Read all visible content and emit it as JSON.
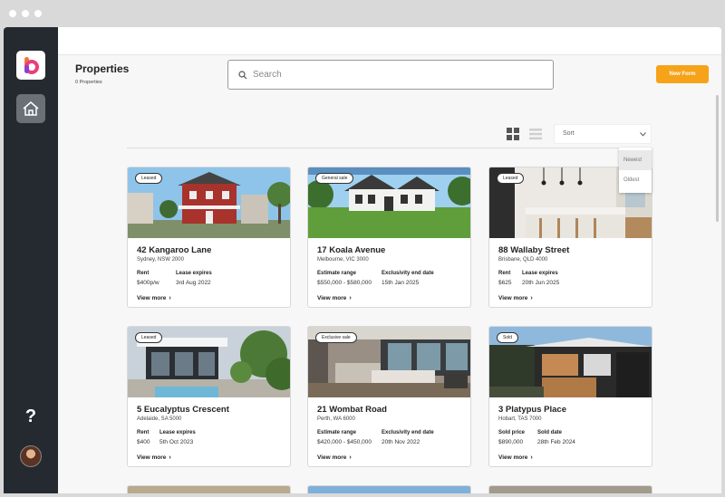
{
  "header": {
    "title": "Properties",
    "count": "0 Properties",
    "search_placeholder": "Search",
    "new_form_label": "New Form"
  },
  "toolbar": {
    "sort_label": "Sort",
    "sort_options": [
      "Newest",
      "Oldest"
    ]
  },
  "colors": {
    "accent": "#f6a31a",
    "sidebar": "#252a30"
  },
  "properties": [
    {
      "badge": "Leased",
      "title": "42 Kangaroo Lane",
      "location": "Sydney, NSW 2000",
      "field1_label": "Rent",
      "field1_value": "$400p/w",
      "field2_label": "Lease expires",
      "field2_value": "3rd Aug 2022",
      "view_more": "View more"
    },
    {
      "badge": "General sale",
      "title": "17 Koala Avenue",
      "location": "Melbourne, VIC 3000",
      "field1_label": "Estimate range",
      "field1_value": "$550,000 - $580,000",
      "field2_label": "Exclusivity end date",
      "field2_value": "15th Jan 2025",
      "view_more": "View more"
    },
    {
      "badge": "Leased",
      "title": "88 Wallaby Street",
      "location": "Brisbane, QLD 4000",
      "field1_label": "Rent",
      "field1_value": "$625",
      "field2_label": "Lease expires",
      "field2_value": "20th Jun 2025",
      "view_more": "View more"
    },
    {
      "badge": "Leased",
      "title": "5 Eucalyptus Crescent",
      "location": "Adelaide, SA 5000",
      "field1_label": "Rent",
      "field1_value": "$400",
      "field2_label": "Lease expires",
      "field2_value": "5th Oct 2023",
      "view_more": "View more"
    },
    {
      "badge": "Exclusive sale",
      "title": "21 Wombat Road",
      "location": "Perth, WA 6000",
      "field1_label": "Estimate range",
      "field1_value": "$420,000 - $450,000",
      "field2_label": "Exclusivity end date",
      "field2_value": "20th Nov 2022",
      "view_more": "View more"
    },
    {
      "badge": "Sold",
      "title": "3 Platypus Place",
      "location": "Hobart, TAS 7000",
      "field1_label": "Sold price",
      "field1_value": "$890,000",
      "field2_label": "Sold date",
      "field2_value": "28th Feb 2024",
      "view_more": "View more"
    }
  ]
}
